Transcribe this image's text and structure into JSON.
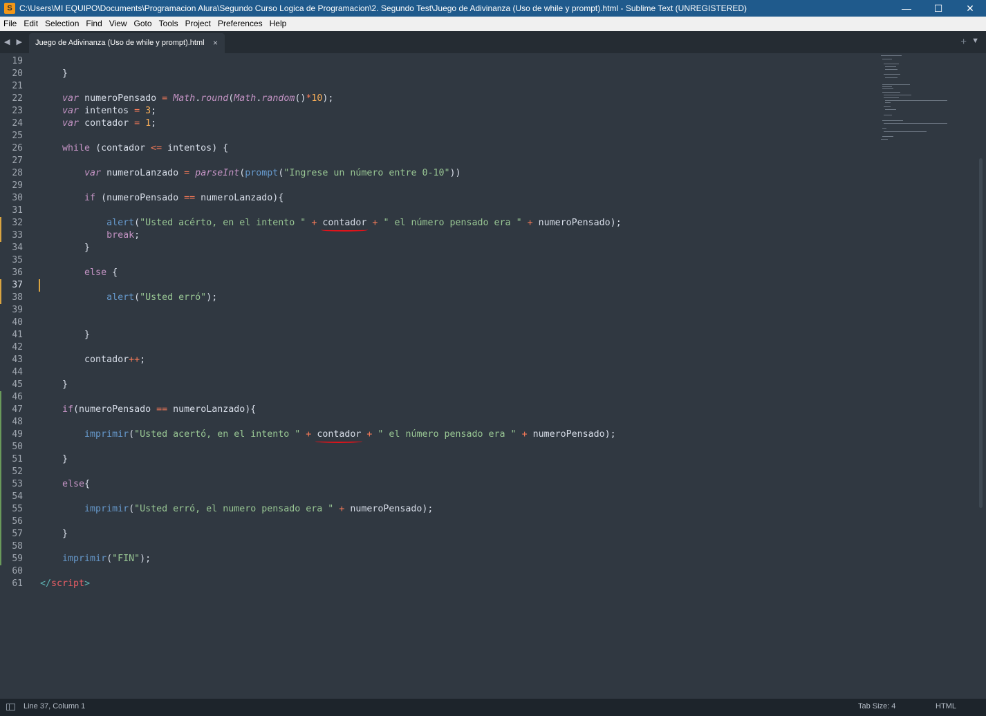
{
  "window": {
    "title": "C:\\Users\\MI EQUIPO\\Documents\\Programacion Alura\\Segundo Curso Logica de Programacion\\2. Segundo Test\\Juego de Adivinanza (Uso de while y prompt).html - Sublime Text (UNREGISTERED)",
    "icon_letter": "S",
    "minimize": "—",
    "maximize": "☐",
    "close": "✕"
  },
  "menu": [
    "File",
    "Edit",
    "Selection",
    "Find",
    "View",
    "Goto",
    "Tools",
    "Project",
    "Preferences",
    "Help"
  ],
  "tabs": {
    "nav_arrows": "◀ ▶",
    "active_tab": "Juego de Adivinanza (Uso de while y prompt).html",
    "close": "×",
    "new_tab": "+",
    "dropdown": "▼"
  },
  "editor": {
    "line_numbers": [
      "19",
      "20",
      "21",
      "22",
      "23",
      "24",
      "25",
      "26",
      "27",
      "28",
      "29",
      "30",
      "31",
      "32",
      "33",
      "34",
      "35",
      "36",
      "37",
      "38",
      "39",
      "40",
      "41",
      "42",
      "43",
      "44",
      "45",
      "46",
      "47",
      "48",
      "49",
      "50",
      "51",
      "52",
      "53",
      "54",
      "55",
      "56",
      "57",
      "58",
      "59",
      "60",
      "61"
    ],
    "active_line": "37"
  },
  "status": {
    "position": "Line 37, Column 1",
    "tab_size": "Tab Size: 4",
    "syntax": "HTML"
  }
}
